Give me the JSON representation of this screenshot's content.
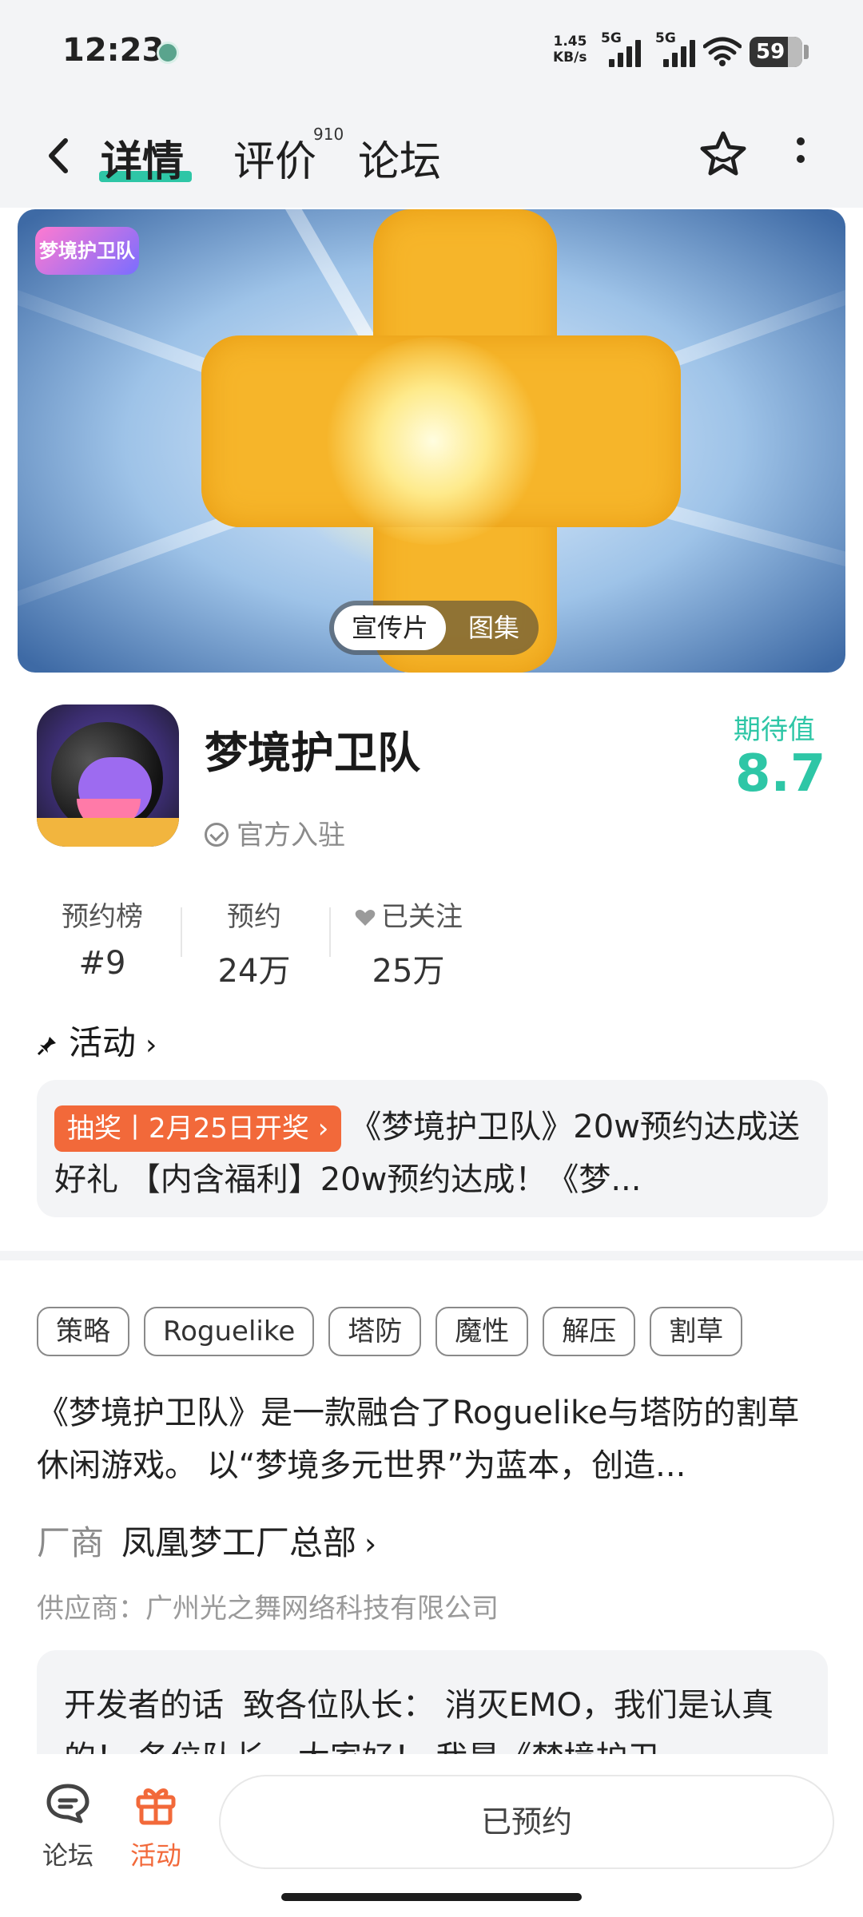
{
  "status_bar": {
    "time": "12:23",
    "speed_value": "1.45",
    "speed_unit": "KB/s",
    "net1": "5G",
    "net2": "5G",
    "battery": "59"
  },
  "nav": {
    "tabs": [
      {
        "label": "详情",
        "active": true
      },
      {
        "label": "评价",
        "badge": "910"
      },
      {
        "label": "论坛"
      }
    ]
  },
  "banner": {
    "logo_text": "梦境护卫队",
    "toggle": [
      "宣传片",
      "图集"
    ]
  },
  "game": {
    "title": "梦境护卫队",
    "verified": "官方入驻",
    "expect_label": "期待值",
    "expect_value": "8.7"
  },
  "stats": [
    {
      "label": "预约榜",
      "value": "#9"
    },
    {
      "label": "预约",
      "value": "24万"
    },
    {
      "label": "已关注",
      "value": "25万"
    }
  ],
  "activity": {
    "header": "活动",
    "badge": "抽奖丨2月25日开奖",
    "text": "《梦境护卫队》20w预约达成送好礼 【内含福利】20w预约达成！《梦..."
  },
  "tags": [
    "策略",
    "Roguelike",
    "塔防",
    "魔性",
    "解压",
    "割草"
  ],
  "description": "《梦境护卫队》是一款融合了Roguelike与塔防的割草休闲游戏。 以“梦境多元世界”为蓝本，创造...",
  "vendor": {
    "label": "厂商",
    "name": "凤凰梦工厂总部"
  },
  "supplier": "供应商：广州光之舞网络科技有限公司",
  "developer_note": {
    "title": "开发者的话",
    "text": "致各位队长： 消灭EMO，我们是认真的！ 各位队长，大家好！ 我是《梦境护卫"
  },
  "bottom_bar": {
    "forum": "论坛",
    "activity": "活动",
    "reserve": "已预约"
  },
  "colors": {
    "accent": "#2ec6a6",
    "orange": "#f2693a",
    "banner_gold": "#f6b52a"
  }
}
